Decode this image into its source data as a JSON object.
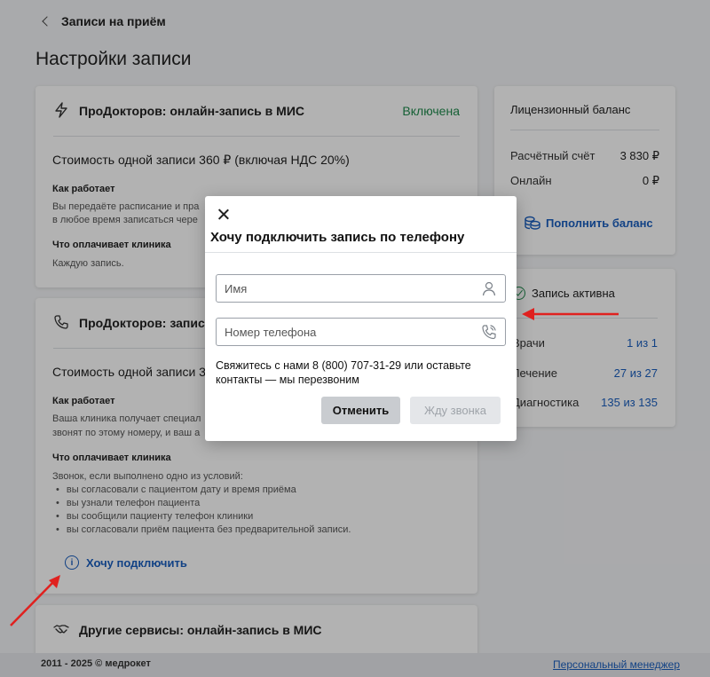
{
  "header": {
    "back_label": "Записи на приём",
    "page_title": "Настройки записи"
  },
  "card_online": {
    "title": "ПроДокторов: онлайн-запись в МИС",
    "status": "Включена",
    "price": "Стоимость одной записи 360 ₽ (включая НДС 20%)",
    "how_title": "Как работает",
    "how_text_1": "Вы передаёте расписание и пра",
    "how_text_2": "в любое время записаться чере",
    "pays_title": "Что оплачивает клиника",
    "pays_text": "Каждую запись."
  },
  "card_phone": {
    "title": "ПроДокторов: запись п",
    "price": "Стоимость одной записи 360",
    "how_title": "Как работает",
    "how_text_1": "Ваша клиника получает специал",
    "how_text_2": "звонят по этому номеру, и ваш а",
    "pays_title": "Что оплачивает клиника",
    "pays_intro": "Звонок, если выполнено одно из условий:",
    "conditions": [
      "вы согласовали с пациентом дату и время приёма",
      "вы узнали телефон пациента",
      "вы сообщили пациенту телефон клиники",
      "вы согласовали приём пациента без предварительной записи."
    ],
    "connect_label": "Хочу подключить"
  },
  "card_other": {
    "title": "Другие сервисы: онлайн-запись в МИС"
  },
  "balance": {
    "title": "Лицензионный баланс",
    "rows": [
      {
        "label": "Расчётный счёт",
        "value": "3 830 ₽"
      },
      {
        "label": "Онлайн",
        "value": "0 ₽"
      }
    ],
    "topup_label": "Пополнить баланс"
  },
  "status_card": {
    "title": "Запись активна",
    "rows": [
      {
        "label": "Врачи",
        "value": "1 из 1"
      },
      {
        "label": "Лечение",
        "value": "27 из 27"
      },
      {
        "label": "Диагностика",
        "value": "135 из 135"
      }
    ]
  },
  "footer": {
    "copyright": "2011 - 2025 © медрокет",
    "manager_link": "Персональный менеджер"
  },
  "modal": {
    "title": "Хочу подключить запись по телефону",
    "name_placeholder": "Имя",
    "phone_placeholder": "Номер телефона",
    "note": "Свяжитесь с нами 8 (800) 707-31-29 или оставьте контакты — мы перезвоним",
    "cancel_label": "Отменить",
    "submit_label": "Жду звонка"
  },
  "colors": {
    "accent": "#1b5fbf",
    "success": "#1f8a4c",
    "annotation_arrow": "#e0211f"
  }
}
